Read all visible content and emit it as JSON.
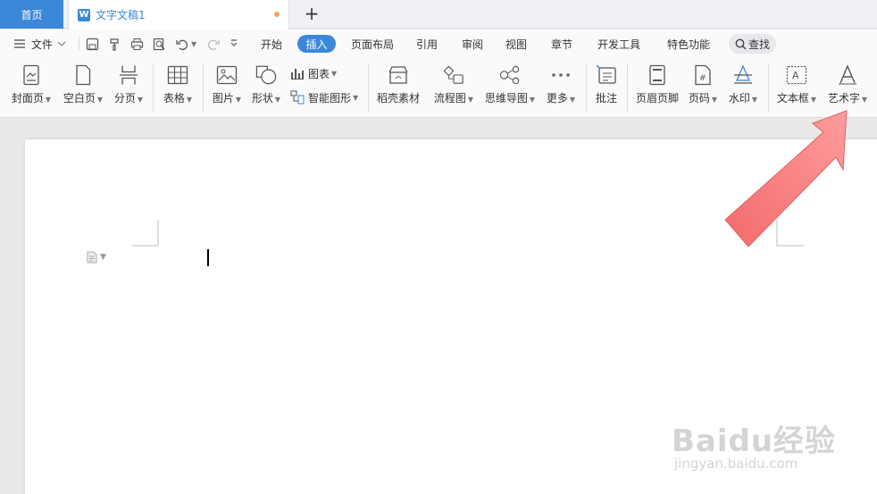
{
  "tabs": {
    "home": "首页",
    "doc": "文字文稿1",
    "add": "+"
  },
  "menu": {
    "file": "文件",
    "items": [
      "开始",
      "插入",
      "页面布局",
      "引用",
      "审阅",
      "视图",
      "章节",
      "开发工具",
      "特色功能"
    ],
    "active": "插入",
    "search": "查找"
  },
  "ribbon": {
    "cover": "封面页",
    "blank": "空白页",
    "pagebreak": "分页",
    "table": "表格",
    "picture": "图片",
    "shape": "形状",
    "chart": "图表",
    "smartart": "智能图形",
    "docer": "稻壳素材",
    "flowchart": "流程图",
    "mindmap": "思维导图",
    "more": "更多",
    "comment": "批注",
    "headerfooter": "页眉页脚",
    "pagenum": "页码",
    "watermark": "水印",
    "textbox": "文本框",
    "wordart": "艺术字"
  },
  "watermark": {
    "brand": "Baidu经验",
    "url": "jingyan.baidu.com"
  },
  "colors": {
    "accent": "#3b87d9",
    "arrow": "#f47b7b"
  }
}
